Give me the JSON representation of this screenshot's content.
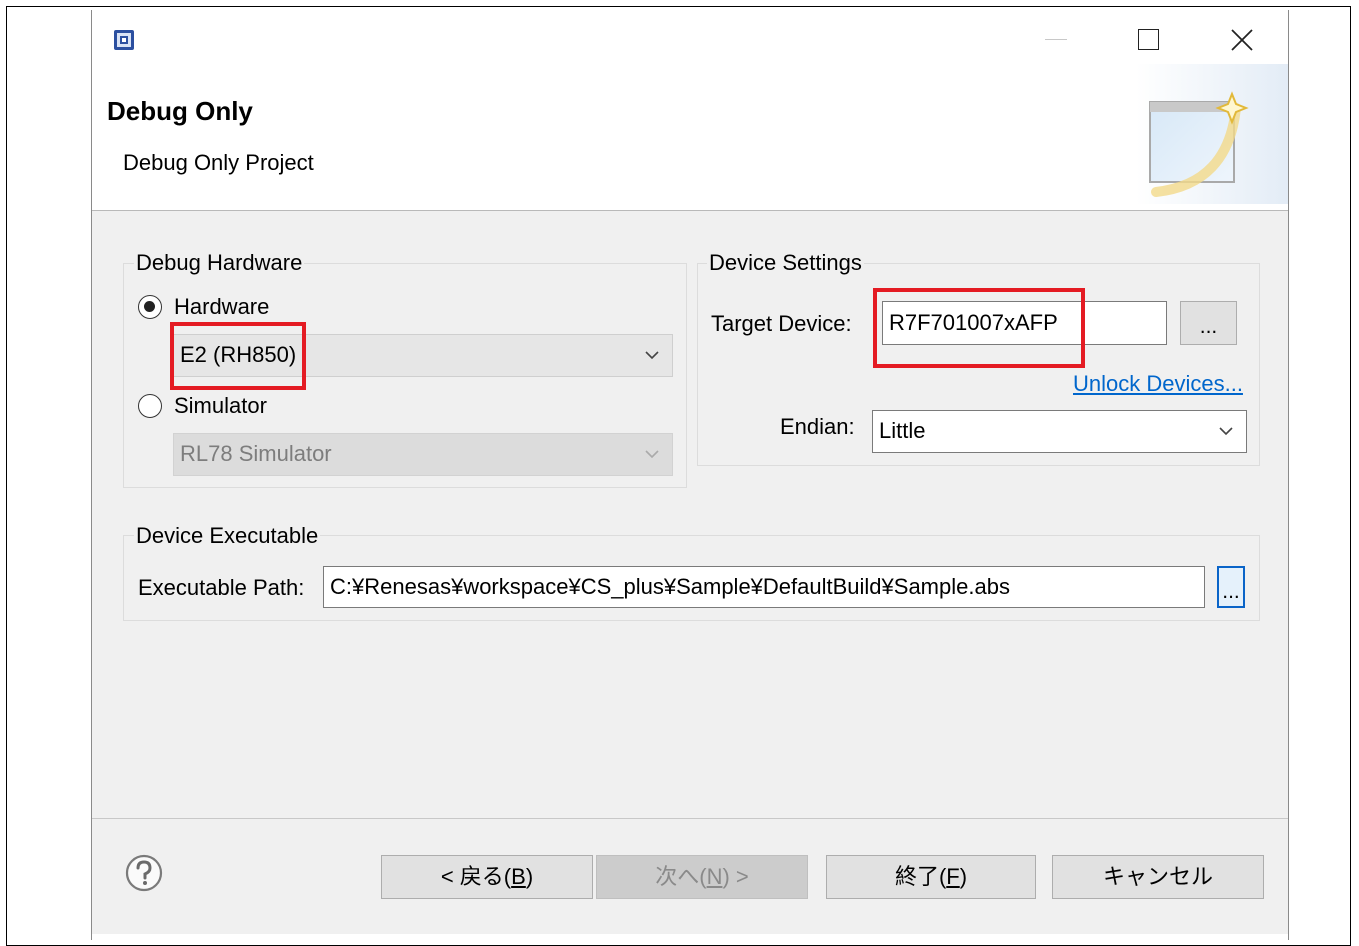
{
  "dialog": {
    "title": "Debug Only",
    "subtitle": "Debug Only Project"
  },
  "debug_hardware": {
    "group_label": "Debug Hardware",
    "hardware_label": "Hardware",
    "hardware_selected": true,
    "hardware_value": "E2 (RH850)",
    "simulator_label": "Simulator",
    "simulator_selected": false,
    "simulator_value": "RL78 Simulator"
  },
  "device_settings": {
    "group_label": "Device Settings",
    "target_device_label": "Target Device:",
    "target_device_value": "R7F701007xAFP",
    "browse_label": "...",
    "unlock_link": "Unlock Devices...",
    "endian_label": "Endian:",
    "endian_value": "Little"
  },
  "device_executable": {
    "group_label": "Device Executable",
    "path_label": "Executable Path:",
    "path_value": "C:¥Renesas¥workspace¥CS_plus¥Sample¥DefaultBuild¥Sample.abs",
    "browse_label": "..."
  },
  "footer": {
    "back": {
      "pre": "< 戻る(",
      "key": "B",
      "post": ")"
    },
    "next": {
      "pre": "次へ(",
      "key": "N",
      "post": ") >"
    },
    "finish": {
      "pre": "終了(",
      "key": "F",
      "post": ")"
    },
    "cancel": "キャンセル"
  },
  "icons": {
    "app": "app-icon",
    "minimize": "minimize-icon",
    "maximize": "maximize-icon",
    "close": "close-icon",
    "wizard": "wizard-banner-icon",
    "help": "help-icon",
    "dropdown": "chevron-down-icon"
  },
  "colors": {
    "highlight": "#e41b23",
    "link": "#0066cc",
    "panel": "#f0f0f0"
  }
}
